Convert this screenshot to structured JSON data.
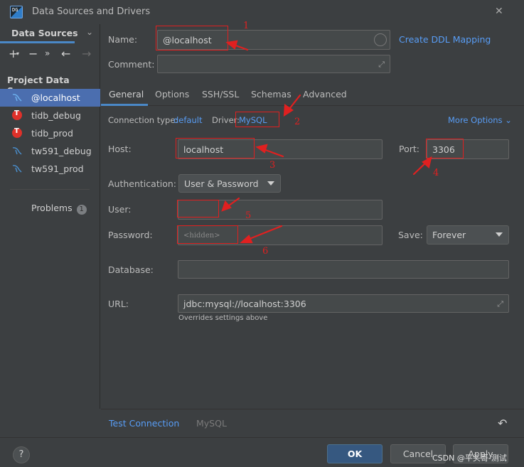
{
  "window": {
    "title": "Data Sources and Drivers",
    "app_icon_text": "DG"
  },
  "sidebar": {
    "header": "Data Sources",
    "section_title": "Project Data Sources",
    "items": [
      {
        "label": "@localhost",
        "icon": "mysql-icon",
        "selected": true
      },
      {
        "label": "tidb_debug",
        "icon": "tidb-icon"
      },
      {
        "label": "tidb_prod",
        "icon": "tidb-icon"
      },
      {
        "label": "tw591_debug",
        "icon": "mysql-icon"
      },
      {
        "label": "tw591_prod",
        "icon": "mysql-icon"
      }
    ],
    "problems_label": "Problems",
    "problems_count": "1"
  },
  "form": {
    "name_label": "Name:",
    "name_value": "@localhost",
    "ddl_link": "Create DDL Mapping",
    "comment_label": "Comment:",
    "comment_value": "",
    "tabs": [
      "General",
      "Options",
      "SSH/SSL",
      "Schemas",
      "Advanced"
    ],
    "active_tab": "General",
    "conn_type_label": "Connection type:",
    "conn_type_value": "default",
    "driver_label": "Driver:",
    "driver_value": "MySQL",
    "more_options": "More Options",
    "host_label": "Host:",
    "host_value": "localhost",
    "port_label": "Port:",
    "port_value": "3306",
    "auth_label": "Authentication:",
    "auth_value": "User & Password",
    "user_label": "User:",
    "user_value": "",
    "password_label": "Password:",
    "password_placeholder": "<hidden>",
    "save_label": "Save:",
    "save_value": "Forever",
    "database_label": "Database:",
    "database_value": "",
    "url_label": "URL:",
    "url_value": "jdbc:mysql://localhost:3306",
    "url_hint": "Overrides settings above"
  },
  "footer": {
    "test_connection": "Test Connection",
    "driver_name": "MySQL"
  },
  "buttons": {
    "help": "?",
    "ok": "OK",
    "cancel": "Cancel",
    "apply": "Apply"
  },
  "annotations": [
    "1",
    "2",
    "3",
    "4",
    "5",
    "6"
  ],
  "watermark": "CSDN @平头哥-测试",
  "colors": {
    "accent": "#4b6eaf",
    "link": "#589df6",
    "annotation": "#e02020",
    "background": "#3c3f41"
  }
}
